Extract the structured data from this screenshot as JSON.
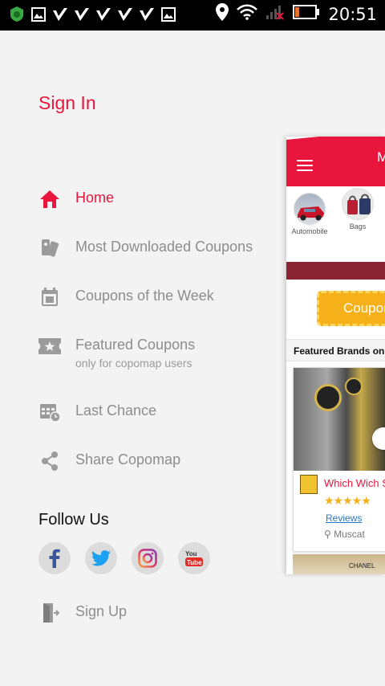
{
  "status_bar": {
    "time": "20:51",
    "left_icons": [
      "shield-app-icon",
      "image-icon",
      "check-icon",
      "check-icon",
      "check-icon",
      "check-icon",
      "check-icon",
      "image-icon"
    ],
    "right_icons": [
      "location-icon",
      "wifi-icon",
      "signal-icon",
      "battery-icon"
    ]
  },
  "drawer": {
    "sign_in": "Sign In",
    "menu": [
      {
        "label": "Home",
        "icon": "home-icon",
        "active": true
      },
      {
        "label": "Most Downloaded Coupons",
        "icon": "coupons-download-icon"
      },
      {
        "label": "Coupons of the Week",
        "icon": "calendar-icon"
      },
      {
        "label": "Featured Coupons",
        "sub": "only for copomap users",
        "icon": "ticket-star-icon"
      },
      {
        "label": "Last Chance",
        "icon": "calendar-clock-icon"
      },
      {
        "label": "Share Copomap",
        "icon": "share-icon"
      }
    ],
    "follow_us": "Follow Us",
    "socials": [
      "facebook-icon",
      "twitter-icon",
      "instagram-icon",
      "youtube-icon"
    ],
    "sign_up": "Sign Up"
  },
  "preview": {
    "title_initial": "M",
    "categories": [
      {
        "label": "Automobile"
      },
      {
        "label": "Bags"
      }
    ],
    "coupon_label": "Coupon",
    "featured_title": "Featured Brands on",
    "brand_name": "Which Wich S",
    "stars": "★★★★★",
    "reviews": "Reviews",
    "location": "Muscat",
    "bottom_text": "CHANEL"
  },
  "colors": {
    "accent": "#e8163d",
    "muted_text": "#8d8d8d",
    "drawer_bg": "#f3f3f3",
    "coupon": "#f6b11a",
    "facebook": "#3b5998",
    "twitter": "#1da1f2",
    "youtube": "#e52d27"
  }
}
